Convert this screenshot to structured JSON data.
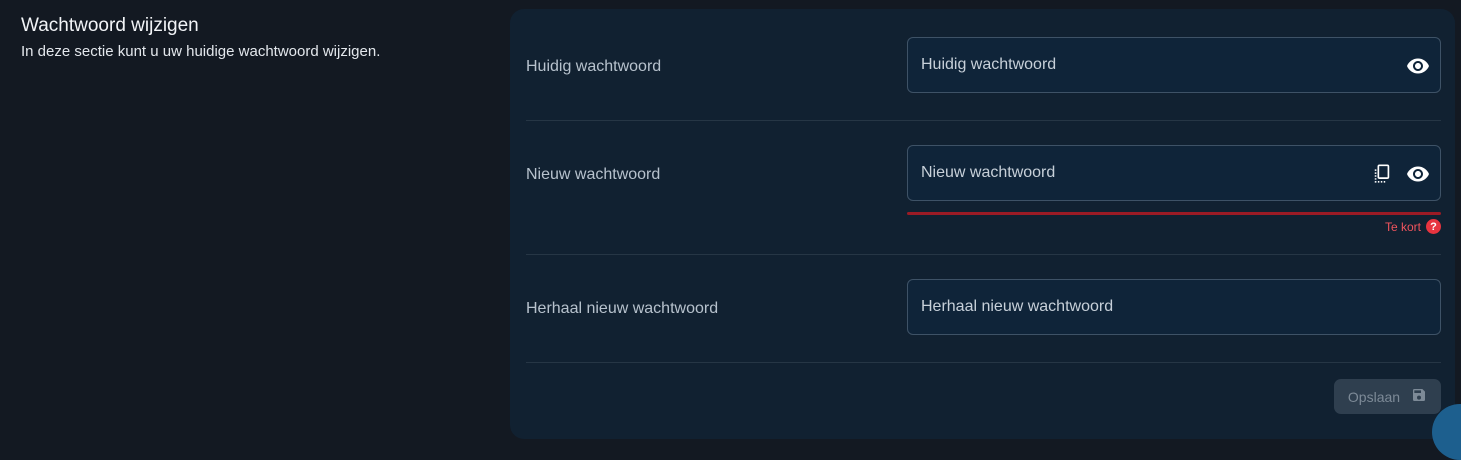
{
  "section": {
    "title": "Wachtwoord wijzigen",
    "description": "In deze sectie kunt u uw huidige wachtwoord wijzigen."
  },
  "fields": {
    "current": {
      "label": "Huidig wachtwoord",
      "placeholder": "Huidig wachtwoord",
      "value": "",
      "icons": [
        "eye-icon"
      ]
    },
    "new": {
      "label": "Nieuw wachtwoord",
      "placeholder": "Nieuw wachtwoord",
      "value": "",
      "icons": [
        "copy-icon",
        "eye-icon"
      ],
      "strength_text": "Te kort",
      "strength_help": "?",
      "strength_color": "#9b1b25"
    },
    "repeat": {
      "label": "Herhaal nieuw wachtwoord",
      "placeholder": "Herhaal nieuw wachtwoord",
      "value": ""
    }
  },
  "actions": {
    "save_label": "Opslaan",
    "save_icon": "floppy-disk-icon",
    "save_disabled": true
  },
  "colors": {
    "background": "#131922",
    "panel": "#112131",
    "field": "#0f2439",
    "error": "#e7343f"
  }
}
